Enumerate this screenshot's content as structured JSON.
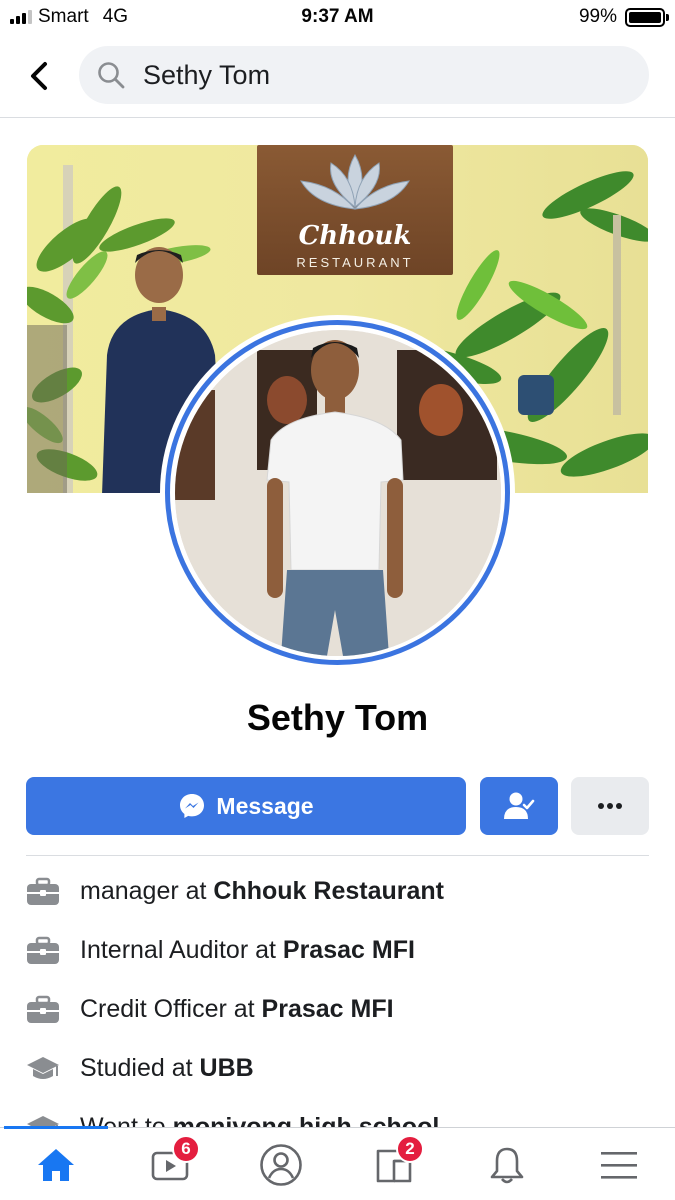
{
  "status_bar": {
    "carrier": "Smart",
    "network": "4G",
    "time": "9:37 AM",
    "battery": "99%",
    "battery_level": 0.99
  },
  "search": {
    "query": "Sethy Tom"
  },
  "cover": {
    "sign_name": "Chhouk",
    "sign_sub": "RESTAURANT"
  },
  "profile": {
    "name": "Sethy Tom"
  },
  "actions": {
    "message_label": "Message"
  },
  "details": [
    {
      "icon": "briefcase-icon",
      "prefix": "manager at ",
      "bold": "Chhouk Restaurant"
    },
    {
      "icon": "briefcase-icon",
      "prefix": "Internal Auditor at ",
      "bold": "Prasac MFI"
    },
    {
      "icon": "briefcase-icon",
      "prefix": "Credit Officer at ",
      "bold": "Prasac MFI"
    },
    {
      "icon": "graduation-cap-icon",
      "prefix": "Studied at ",
      "bold": "UBB"
    },
    {
      "icon": "graduation-cap-icon",
      "prefix": "Went to ",
      "bold": "monivong high school"
    }
  ],
  "bottom_nav": {
    "watch_badge": "6",
    "pages_badge": "2"
  },
  "colors": {
    "brand_blue": "#1877f2",
    "button_blue": "#3b76e2",
    "badge_red": "#e41e3f"
  }
}
